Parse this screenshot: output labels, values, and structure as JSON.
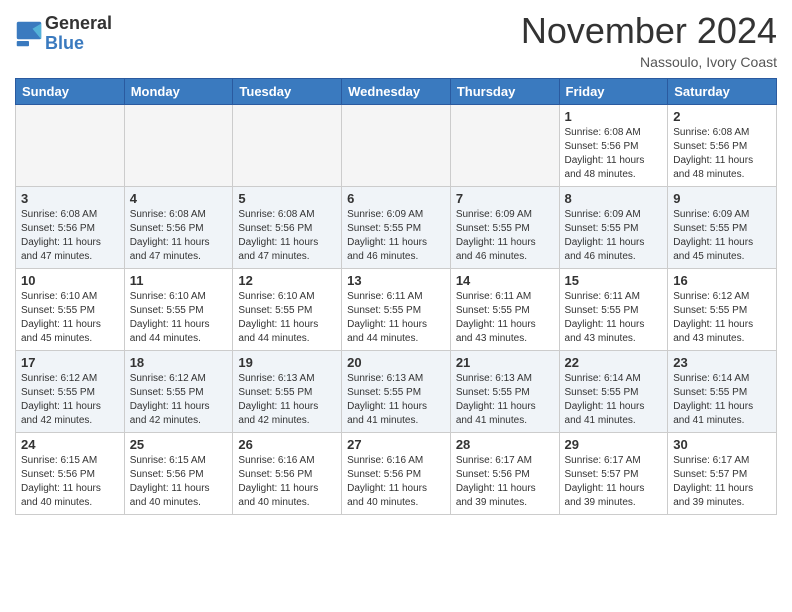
{
  "logo": {
    "general": "General",
    "blue": "Blue"
  },
  "title": "November 2024",
  "location": "Nassoulo, Ivory Coast",
  "headers": [
    "Sunday",
    "Monday",
    "Tuesday",
    "Wednesday",
    "Thursday",
    "Friday",
    "Saturday"
  ],
  "weeks": [
    [
      {
        "day": "",
        "info": ""
      },
      {
        "day": "",
        "info": ""
      },
      {
        "day": "",
        "info": ""
      },
      {
        "day": "",
        "info": ""
      },
      {
        "day": "",
        "info": ""
      },
      {
        "day": "1",
        "info": "Sunrise: 6:08 AM\nSunset: 5:56 PM\nDaylight: 11 hours\nand 48 minutes."
      },
      {
        "day": "2",
        "info": "Sunrise: 6:08 AM\nSunset: 5:56 PM\nDaylight: 11 hours\nand 48 minutes."
      }
    ],
    [
      {
        "day": "3",
        "info": "Sunrise: 6:08 AM\nSunset: 5:56 PM\nDaylight: 11 hours\nand 47 minutes."
      },
      {
        "day": "4",
        "info": "Sunrise: 6:08 AM\nSunset: 5:56 PM\nDaylight: 11 hours\nand 47 minutes."
      },
      {
        "day": "5",
        "info": "Sunrise: 6:08 AM\nSunset: 5:56 PM\nDaylight: 11 hours\nand 47 minutes."
      },
      {
        "day": "6",
        "info": "Sunrise: 6:09 AM\nSunset: 5:55 PM\nDaylight: 11 hours\nand 46 minutes."
      },
      {
        "day": "7",
        "info": "Sunrise: 6:09 AM\nSunset: 5:55 PM\nDaylight: 11 hours\nand 46 minutes."
      },
      {
        "day": "8",
        "info": "Sunrise: 6:09 AM\nSunset: 5:55 PM\nDaylight: 11 hours\nand 46 minutes."
      },
      {
        "day": "9",
        "info": "Sunrise: 6:09 AM\nSunset: 5:55 PM\nDaylight: 11 hours\nand 45 minutes."
      }
    ],
    [
      {
        "day": "10",
        "info": "Sunrise: 6:10 AM\nSunset: 5:55 PM\nDaylight: 11 hours\nand 45 minutes."
      },
      {
        "day": "11",
        "info": "Sunrise: 6:10 AM\nSunset: 5:55 PM\nDaylight: 11 hours\nand 44 minutes."
      },
      {
        "day": "12",
        "info": "Sunrise: 6:10 AM\nSunset: 5:55 PM\nDaylight: 11 hours\nand 44 minutes."
      },
      {
        "day": "13",
        "info": "Sunrise: 6:11 AM\nSunset: 5:55 PM\nDaylight: 11 hours\nand 44 minutes."
      },
      {
        "day": "14",
        "info": "Sunrise: 6:11 AM\nSunset: 5:55 PM\nDaylight: 11 hours\nand 43 minutes."
      },
      {
        "day": "15",
        "info": "Sunrise: 6:11 AM\nSunset: 5:55 PM\nDaylight: 11 hours\nand 43 minutes."
      },
      {
        "day": "16",
        "info": "Sunrise: 6:12 AM\nSunset: 5:55 PM\nDaylight: 11 hours\nand 43 minutes."
      }
    ],
    [
      {
        "day": "17",
        "info": "Sunrise: 6:12 AM\nSunset: 5:55 PM\nDaylight: 11 hours\nand 42 minutes."
      },
      {
        "day": "18",
        "info": "Sunrise: 6:12 AM\nSunset: 5:55 PM\nDaylight: 11 hours\nand 42 minutes."
      },
      {
        "day": "19",
        "info": "Sunrise: 6:13 AM\nSunset: 5:55 PM\nDaylight: 11 hours\nand 42 minutes."
      },
      {
        "day": "20",
        "info": "Sunrise: 6:13 AM\nSunset: 5:55 PM\nDaylight: 11 hours\nand 41 minutes."
      },
      {
        "day": "21",
        "info": "Sunrise: 6:13 AM\nSunset: 5:55 PM\nDaylight: 11 hours\nand 41 minutes."
      },
      {
        "day": "22",
        "info": "Sunrise: 6:14 AM\nSunset: 5:55 PM\nDaylight: 11 hours\nand 41 minutes."
      },
      {
        "day": "23",
        "info": "Sunrise: 6:14 AM\nSunset: 5:55 PM\nDaylight: 11 hours\nand 41 minutes."
      }
    ],
    [
      {
        "day": "24",
        "info": "Sunrise: 6:15 AM\nSunset: 5:56 PM\nDaylight: 11 hours\nand 40 minutes."
      },
      {
        "day": "25",
        "info": "Sunrise: 6:15 AM\nSunset: 5:56 PM\nDaylight: 11 hours\nand 40 minutes."
      },
      {
        "day": "26",
        "info": "Sunrise: 6:16 AM\nSunset: 5:56 PM\nDaylight: 11 hours\nand 40 minutes."
      },
      {
        "day": "27",
        "info": "Sunrise: 6:16 AM\nSunset: 5:56 PM\nDaylight: 11 hours\nand 40 minutes."
      },
      {
        "day": "28",
        "info": "Sunrise: 6:17 AM\nSunset: 5:56 PM\nDaylight: 11 hours\nand 39 minutes."
      },
      {
        "day": "29",
        "info": "Sunrise: 6:17 AM\nSunset: 5:57 PM\nDaylight: 11 hours\nand 39 minutes."
      },
      {
        "day": "30",
        "info": "Sunrise: 6:17 AM\nSunset: 5:57 PM\nDaylight: 11 hours\nand 39 minutes."
      }
    ]
  ]
}
